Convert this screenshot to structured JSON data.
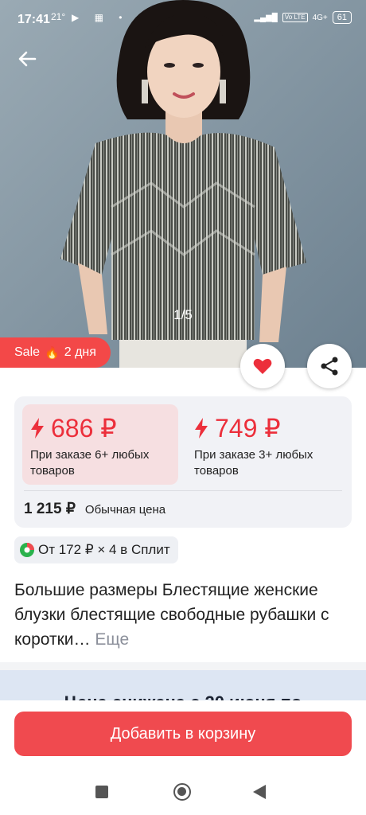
{
  "status_bar": {
    "time": "17:41",
    "temperature": "21°",
    "network": "4G+",
    "lte_tag": "Vo LTE",
    "battery": "61"
  },
  "gallery": {
    "pager": "1/5"
  },
  "sale_badge": {
    "label": "Sale",
    "duration": "2 дня"
  },
  "prices": {
    "option_1": {
      "price": "686 ₽",
      "condition": "При заказе 6+ любых товаров"
    },
    "option_2": {
      "price": "749 ₽",
      "condition": "При заказе 3+ любых товаров"
    },
    "regular_price": "1 215 ₽",
    "regular_label": "Обычная цена"
  },
  "split": {
    "text": "От 172 ₽ × 4 в Сплит"
  },
  "product": {
    "title": "Большие размеры Блестящие женские блузки блестящие свободные рубашки с коротки…",
    "more_label": "Еще"
  },
  "promo": {
    "text": "Цена снижена с 20 июня по"
  },
  "cart": {
    "button_label": "Добавить в корзину"
  },
  "colors": {
    "accent_red": "#f04a4f",
    "price_red": "#ec2f3b",
    "selected_option_bg": "#f6dfe1"
  }
}
